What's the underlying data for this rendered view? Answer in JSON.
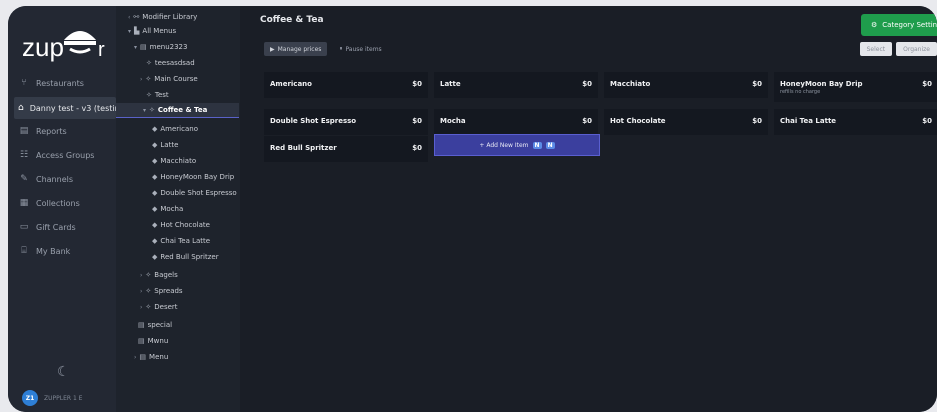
{
  "app": {
    "logo_text": "zup",
    "logo_tail": "r"
  },
  "sidebar": {
    "items": [
      {
        "label": "Restaurants",
        "icon": "fork-knife-icon"
      },
      {
        "label": "Danny test - v3 (testin",
        "icon": "home-icon"
      },
      {
        "label": "Reports",
        "icon": "report-icon"
      },
      {
        "label": "Access Groups",
        "icon": "users-icon"
      },
      {
        "label": "Channels",
        "icon": "broadcast-icon"
      },
      {
        "label": "Collections",
        "icon": "collections-icon"
      },
      {
        "label": "Gift Cards",
        "icon": "gift-card-icon"
      },
      {
        "label": "My Bank",
        "icon": "bank-icon"
      }
    ],
    "user": {
      "initials": "Z1",
      "name": "ZUPPLER 1 E"
    }
  },
  "tree": {
    "items": [
      {
        "label": "Modifier Library"
      },
      {
        "label": "All Menus"
      },
      {
        "label": "menu2323"
      },
      {
        "label": "teesasdsad"
      },
      {
        "label": "Main Course"
      },
      {
        "label": "Test"
      },
      {
        "label": "Coffee & Tea"
      },
      {
        "label": "Americano"
      },
      {
        "label": "Latte"
      },
      {
        "label": "Macchiato"
      },
      {
        "label": "HoneyMoon Bay Drip"
      },
      {
        "label": "Double Shot Espresso"
      },
      {
        "label": "Mocha"
      },
      {
        "label": "Hot Chocolate"
      },
      {
        "label": "Chai Tea Latte"
      },
      {
        "label": "Red Bull Spritzer"
      },
      {
        "label": "Bagels"
      },
      {
        "label": "Spreads"
      },
      {
        "label": "Desert"
      },
      {
        "label": "special"
      },
      {
        "label": "Mwnu"
      },
      {
        "label": "Menu"
      }
    ]
  },
  "main": {
    "title": "Coffee & Tea",
    "category_settings": "Category Settin",
    "manage_prices": "Manage prices",
    "pause_items": "Pause items",
    "select": "Select",
    "organize": "Organize",
    "items": [
      {
        "name": "Americano",
        "price": "$0",
        "sub": ""
      },
      {
        "name": "Latte",
        "price": "$0",
        "sub": ""
      },
      {
        "name": "Macchiato",
        "price": "$0",
        "sub": ""
      },
      {
        "name": "HoneyMoon Bay Drip",
        "price": "$0",
        "sub": "refills no charge"
      },
      {
        "name": "Double Shot Espresso",
        "price": "$0",
        "sub": ""
      },
      {
        "name": "Mocha",
        "price": "$0",
        "sub": ""
      },
      {
        "name": "Hot Chocolate",
        "price": "$0",
        "sub": ""
      },
      {
        "name": "Chai Tea Latte",
        "price": "$0",
        "sub": ""
      },
      {
        "name": "Red Bull Spritzer",
        "price": "$0",
        "sub": ""
      }
    ],
    "add_new_item": "+ Add New Item",
    "badges": [
      "N",
      "N"
    ]
  },
  "colors": {
    "accent_green": "#1f9d4c",
    "accent_purple": "#3b3f9e"
  }
}
